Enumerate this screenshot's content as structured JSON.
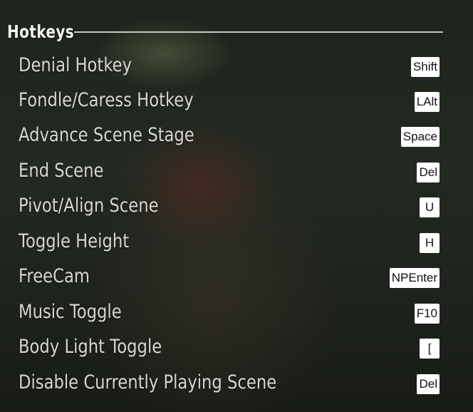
{
  "section": {
    "title": "Hotkeys"
  },
  "hotkeys": [
    {
      "label": "Denial Hotkey",
      "key": "Shift"
    },
    {
      "label": "Fondle/Caress Hotkey",
      "key": "LAlt"
    },
    {
      "label": "Advance Scene Stage",
      "key": "Space"
    },
    {
      "label": "End Scene",
      "key": "Del"
    },
    {
      "label": "Pivot/Align Scene",
      "key": "U"
    },
    {
      "label": "Toggle Height",
      "key": "H"
    },
    {
      "label": "FreeCam",
      "key": "NPEnter"
    },
    {
      "label": "Music Toggle",
      "key": "F10"
    },
    {
      "label": "Body Light Toggle",
      "key": "["
    },
    {
      "label": "Disable Currently Playing Scene",
      "key": "Del"
    }
  ]
}
